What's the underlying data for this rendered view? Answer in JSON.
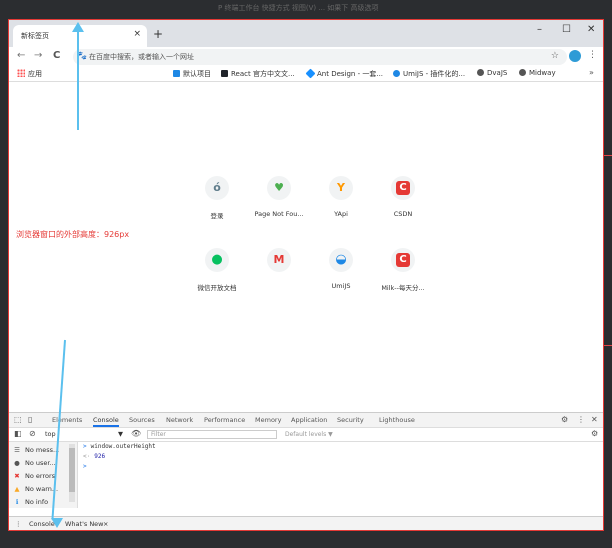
{
  "background": {
    "text": "P  终端工作台  快捷方式  视图(V)  ... 如果下  高级选项"
  },
  "browser": {
    "tab_title": "新标签页",
    "tab_close": "×",
    "new_tab": "+",
    "window_controls": [
      "–",
      "☐",
      "✕"
    ],
    "nav": {
      "back": "←",
      "forward": "→",
      "reload": "C"
    },
    "omnibox_placeholder": "在百度中搜索，或者输入一个网址",
    "star": "☆",
    "menu": "⋮",
    "apps_label": "应用",
    "bookmarks": [
      {
        "label": "默认项目",
        "color": "#1e88e5"
      },
      {
        "label": "React 官方中文文...",
        "color": "#20232a"
      },
      {
        "label": "Ant Design - 一套...",
        "color": "#1890ff"
      },
      {
        "label": "UmiJS - 插件化的...",
        "color": "#1e88e5"
      },
      {
        "label": "DvaJS",
        "color": "#555555"
      },
      {
        "label": "Midway",
        "color": "#555555"
      }
    ],
    "bookmarks_more": "»"
  },
  "shortcuts": [
    {
      "label": "登录",
      "glyph": "ó",
      "color": "#607d8b"
    },
    {
      "label": "Page Not Fou...",
      "glyph": "♥",
      "color": "#4caf50"
    },
    {
      "label": "YApi",
      "glyph": "Y",
      "color": "#ff9800"
    },
    {
      "label": "CSDN",
      "glyph": "C",
      "color": "#e53935"
    },
    {
      "label": "微信开放文档",
      "glyph": "●",
      "color": "#07c160"
    },
    {
      "label": "",
      "glyph": "M",
      "color": "#e53935"
    },
    {
      "label": "UmiJS",
      "glyph": "◒",
      "color": "#1e88e5"
    },
    {
      "label": "Milk--每天分...",
      "glyph": "C",
      "color": "#e53935"
    }
  ],
  "annotation": "浏览器窗口的外部高度：926px",
  "devtools": {
    "tabs": [
      "Elements",
      "Console",
      "Sources",
      "Network",
      "Performance",
      "Memory",
      "Application",
      "Security",
      "Lighthouse"
    ],
    "active_tab": "Console",
    "context": "top",
    "filter_placeholder": "Filter",
    "levels": "Default levels ▼",
    "sidebar": [
      {
        "label": "No mess...",
        "icon": "☰",
        "color": "#555555"
      },
      {
        "label": "No user...",
        "icon": "●",
        "color": "#555555"
      },
      {
        "label": "No errors",
        "icon": "✖",
        "color": "#e53935"
      },
      {
        "label": "No warn...",
        "icon": "▲",
        "color": "#f9a825"
      },
      {
        "label": "No info",
        "icon": "ℹ",
        "color": "#1e88e5"
      }
    ],
    "console_lines": [
      {
        "prompt": ">",
        "text": "window.outerHeight"
      },
      {
        "prompt": "<·",
        "text": "926"
      },
      {
        "prompt": ">",
        "text": ""
      }
    ],
    "drawer": {
      "console": "Console",
      "whats_new": "What's New",
      "close": "×",
      "menu": "⋮"
    }
  }
}
